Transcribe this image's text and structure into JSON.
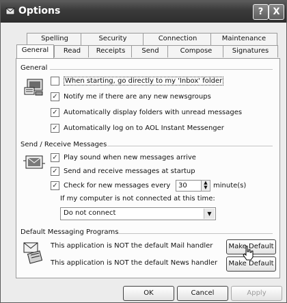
{
  "window": {
    "title": "Options",
    "help_label": "?",
    "close_label": "X"
  },
  "tabs_back": [
    {
      "label": "Spelling"
    },
    {
      "label": "Security"
    },
    {
      "label": "Connection"
    },
    {
      "label": "Maintenance"
    }
  ],
  "tabs_front": [
    {
      "label": "General",
      "active": true
    },
    {
      "label": "Read"
    },
    {
      "label": "Receipts"
    },
    {
      "label": "Send"
    },
    {
      "label": "Compose"
    },
    {
      "label": "Signatures"
    }
  ],
  "general": {
    "title": "General",
    "options": [
      {
        "label": "When starting, go directly to my 'Inbox' folder",
        "checked": false
      },
      {
        "label": "Notify me if there are any new newsgroups",
        "checked": true
      },
      {
        "label": "Automatically display folders with unread messages",
        "checked": true
      },
      {
        "label": "Automatically log on to AOL Instant Messenger",
        "checked": true
      }
    ]
  },
  "send_receive": {
    "title": "Send / Receive Messages",
    "options": [
      {
        "label": "Play sound when new messages arrive",
        "checked": true
      },
      {
        "label": "Send and receive messages at startup",
        "checked": true
      },
      {
        "label": "Check for new messages every",
        "checked": true
      }
    ],
    "interval_value": "30",
    "interval_unit": "minute(s)",
    "offline_label": "If my computer is not connected at this time:",
    "offline_select": "Do not connect"
  },
  "default_programs": {
    "title": "Default Messaging Programs",
    "mail_text": "This application is NOT the default Mail handler",
    "news_text": "This application is NOT the default News handler",
    "make_default_mail": "Make Default",
    "make_default_news": "Make Default"
  },
  "footer": {
    "ok": "OK",
    "cancel": "Cancel",
    "apply": "Apply"
  }
}
